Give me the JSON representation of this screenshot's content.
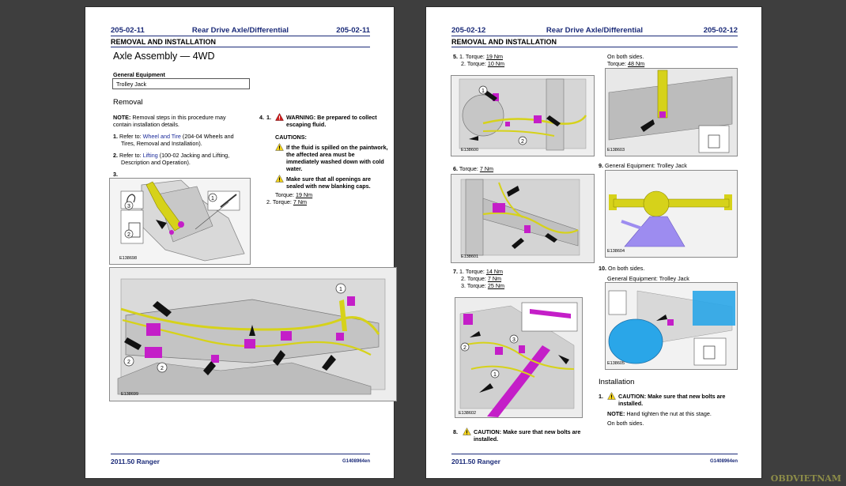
{
  "left_page": {
    "header_left": "205-02-11",
    "header_center": "Rear Drive Axle/Differential",
    "header_right": "205-02-11",
    "section": "REMOVAL AND INSTALLATION",
    "title": "Axle Assembly — 4WD",
    "general_equipment_label": "General Equipment",
    "general_equipment_value": "Trolley Jack",
    "removal_heading": "Removal",
    "note_label": "NOTE:",
    "note_line1": "Removal steps in this procedure may",
    "note_line2": "contain installation details.",
    "step1_num": "1.",
    "step1_refer": "Refer to:",
    "step1_link": "Wheel and Tire",
    "step1_rest": "(204-04 Wheels and",
    "step1_line2": "Tires, Removal and Installation).",
    "step2_num": "2.",
    "step2_refer": "Refer to:",
    "step2_link": "Lifting",
    "step2_rest": "(100-02 Jacking and Lifting,",
    "step2_line2": "Description and Operation).",
    "step3_num": "3.",
    "step4_num": "4.",
    "step4_sub": "1.",
    "warning_line1": "WARNING: Be prepared to collect",
    "warning_line2": "escaping fluid.",
    "cautions_label": "CAUTIONS:",
    "caution1_line1": "If the fluid is spilled on the paintwork,",
    "caution1_line2": "the affected area must be",
    "caution1_line3": "immediately washed down with cold",
    "caution1_line4": "water.",
    "caution2_line1": "Make sure that all openings are",
    "caution2_line2": "sealed with new blanking caps.",
    "torque1_label": "Torque:",
    "torque1_value": "19 Nm",
    "sub2_num": "2.",
    "torque2_label": "Torque:",
    "torque2_value": "7 Nm",
    "fig1_id": "E138698",
    "fig2_id": "E138699",
    "footer_left": "2011.50 Ranger",
    "footer_right": "G1408964en"
  },
  "right_page": {
    "header_left": "205-02-12",
    "header_center": "Rear Drive Axle/Differential",
    "header_right": "205-02-12",
    "section": "REMOVAL AND INSTALLATION",
    "s5_num": "5.",
    "s5_1": "1.",
    "s5_1_label": "Torque:",
    "s5_1_value": "19 Nm",
    "s5_2": "2.",
    "s5_2_label": "Torque:",
    "s5_2_value": "10 Nm",
    "on_both_sides_1": "On both sides.",
    "s_torque48_label": "Torque:",
    "s_torque48_value": "48 Nm",
    "s6_num": "6.",
    "s6_label": "Torque:",
    "s6_value": "7 Nm",
    "s7_num": "7.",
    "s7_1": "1.",
    "s7_1_label": "Torque:",
    "s7_1_value": "14 Nm",
    "s7_2": "2.",
    "s7_2_label": "Torque:",
    "s7_2_value": "7 Nm",
    "s7_3": "3.",
    "s7_3_label": "Torque:",
    "s7_3_value": "25 Nm",
    "s8_num": "8.",
    "s8_line1": "CAUTION: Make sure that new bolts are",
    "s8_line2": "installed.",
    "s9_num": "9.",
    "s9_text": "General Equipment: Trolley Jack",
    "s10_num": "10.",
    "s10_text": "On both sides.",
    "s10_equip": "General Equipment: Trolley Jack",
    "installation_heading": "Installation",
    "i1_num": "1.",
    "i1_line1": "CAUTION: Make sure that new bolts are",
    "i1_line2": "installed.",
    "i_note_label": "NOTE:",
    "i_note_text": "Hand tighten the nut at this stage.",
    "i_on_both": "On both sides.",
    "fig_5": "E138600",
    "fig_6": "E138601",
    "fig_7": "E138602",
    "fig_r1": "E138603",
    "fig_9": "E138604",
    "fig_10": "E138605",
    "footer_left": "2011.50 Ranger",
    "footer_right": "G1408964en"
  },
  "watermark": "OBDVIETNAM",
  "colors": {
    "header_blue": "#1a2a78",
    "highlight_yellow": "#d6d21a",
    "highlight_magenta": "#c41ec8",
    "highlight_cyan": "#2aa6e8",
    "jack_purple": "#9d8cf0",
    "warning_red": "#d02020",
    "caution_yellow": "#f2d21a"
  }
}
